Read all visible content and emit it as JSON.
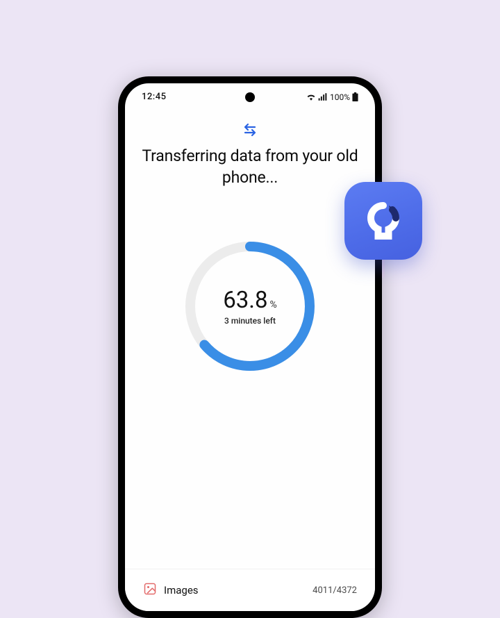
{
  "status": {
    "time": "12:45",
    "battery_text": "100%"
  },
  "app": {
    "title": "Transferring data from your old phone..."
  },
  "progress": {
    "percent_value": "63.8",
    "percent_sign": "%",
    "percent_numeric": 63.8,
    "time_left": "3 minutes left"
  },
  "current_item": {
    "icon": "images-icon",
    "label": "Images",
    "count": "4011/4372"
  },
  "colors": {
    "ring_fill": "#3a8ee6",
    "ring_track": "#ececec",
    "badge_bg": "#4d6be8",
    "accent": "#2b64e3"
  }
}
